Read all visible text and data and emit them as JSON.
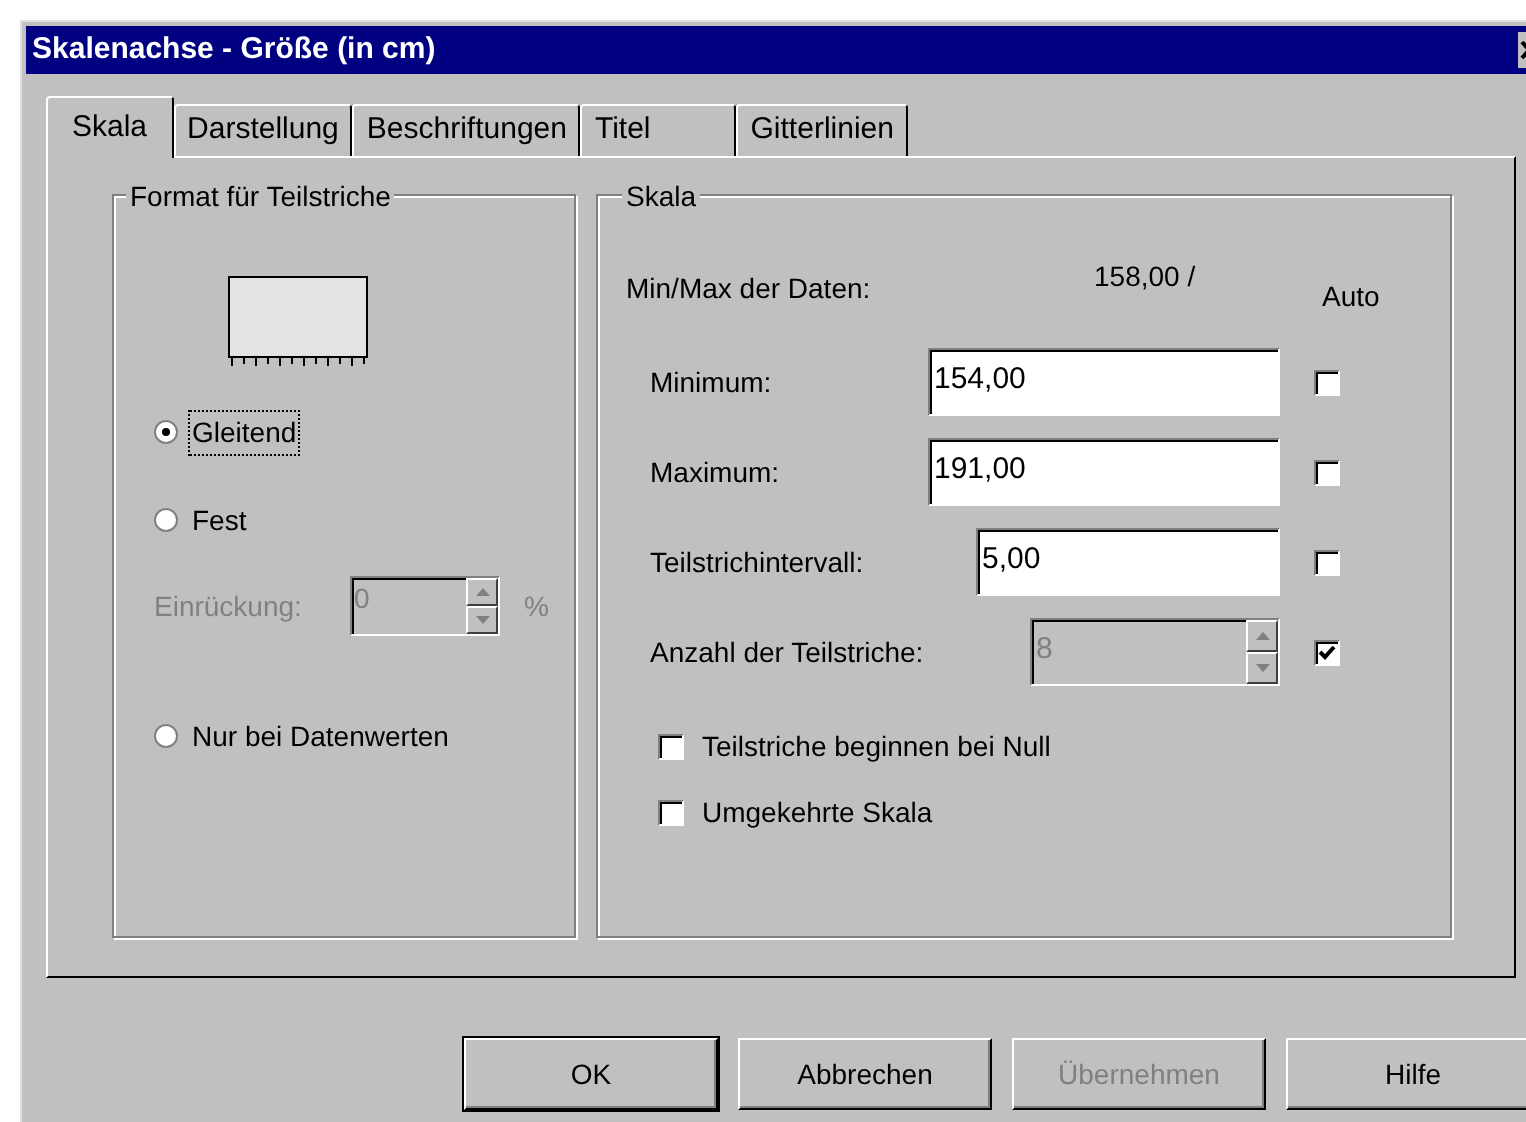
{
  "window": {
    "title": "Skalenachse - Größe (in cm)"
  },
  "tabs": [
    {
      "label": "Skala",
      "selected": true
    },
    {
      "label": "Darstellung",
      "selected": false
    },
    {
      "label": "Beschriftungen",
      "selected": false
    },
    {
      "label": "Titel",
      "selected": false
    },
    {
      "label": "Gitterlinien",
      "selected": false
    }
  ],
  "tick_format": {
    "title": "Format für Teilstriche",
    "options": [
      {
        "label": "Gleitend",
        "selected": true,
        "focused": true
      },
      {
        "label": "Fest",
        "selected": false,
        "focused": false
      },
      {
        "label": "Nur bei Datenwerten",
        "selected": false,
        "focused": false
      }
    ],
    "indent": {
      "label": "Einrückung:",
      "value": "0",
      "unit": "%",
      "disabled": true
    }
  },
  "scale": {
    "title": "Skala",
    "data_label": "Min/Max der Daten:",
    "data_value": "158,00 /",
    "auto_header": "Auto",
    "rows": [
      {
        "label": "Minimum:",
        "value": "154,00",
        "kind": "input",
        "disabled": false,
        "auto": false
      },
      {
        "label": "Maximum:",
        "value": "191,00",
        "kind": "input",
        "disabled": false,
        "auto": false
      },
      {
        "label": "Teilstrichintervall:",
        "value": "5,00",
        "kind": "input",
        "disabled": false,
        "auto": false
      },
      {
        "label": "Anzahl der Teilstriche:",
        "value": "8",
        "kind": "spinner",
        "disabled": true,
        "auto": true
      }
    ],
    "options": [
      {
        "label": "Teilstriche beginnen bei Null",
        "checked": false
      },
      {
        "label": "Umgekehrte Skala",
        "checked": false
      }
    ]
  },
  "buttons": [
    {
      "label": "OK",
      "default": true,
      "disabled": false
    },
    {
      "label": "Abbrechen",
      "default": false,
      "disabled": false
    },
    {
      "label": "Übernehmen",
      "default": false,
      "disabled": true
    },
    {
      "label": "Hilfe",
      "default": false,
      "disabled": false
    }
  ]
}
